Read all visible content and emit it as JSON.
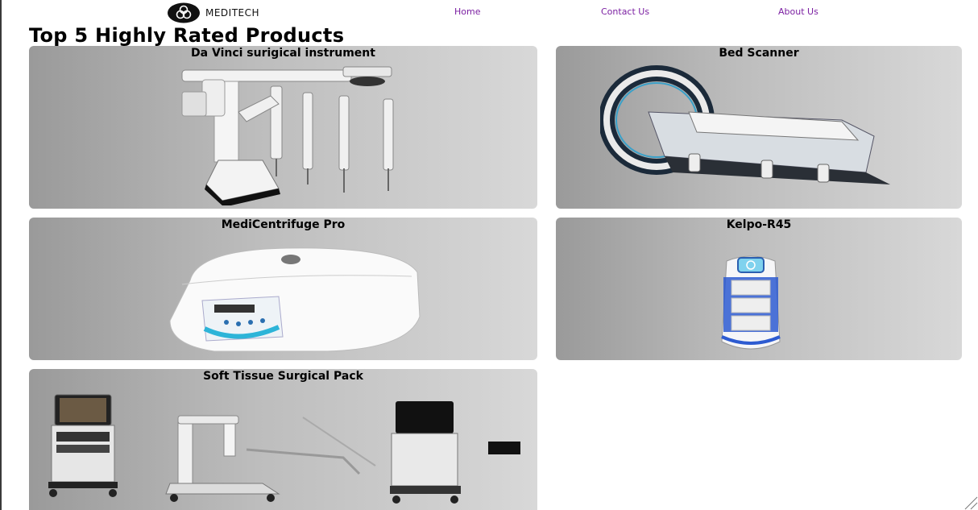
{
  "brand": {
    "name": "MEDITECH"
  },
  "nav": {
    "home": "Home",
    "contact": "Contact Us",
    "about": "About Us"
  },
  "page": {
    "title": "Top 5 Highly Rated Products"
  },
  "products": [
    {
      "title": "Da Vinci surigical instrument",
      "icon": "robotic-surgery-arms"
    },
    {
      "title": "Bed Scanner",
      "icon": "ct-scanner"
    },
    {
      "title": "MediCentrifuge Pro",
      "icon": "centrifuge"
    },
    {
      "title": "Kelpo-R45",
      "icon": "delivery-robot"
    },
    {
      "title": "Soft Tissue Surgical Pack",
      "icon": "surgical-carts"
    }
  ],
  "colors": {
    "nav_link": "#7b1fa2",
    "card_gradient_start": "#9a9a9a",
    "card_gradient_end": "#d8d8d8"
  }
}
